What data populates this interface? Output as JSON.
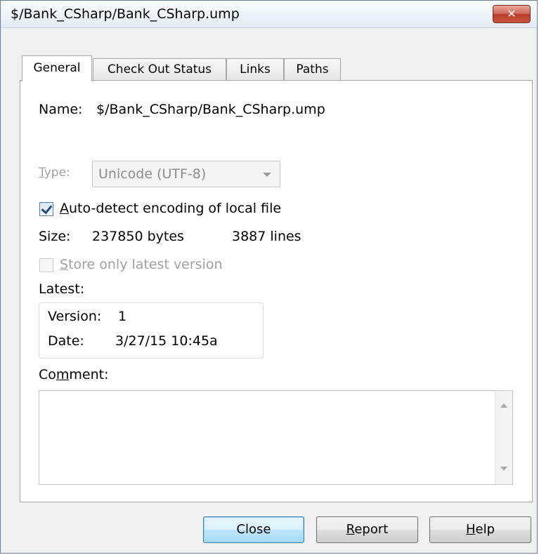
{
  "window": {
    "title": "$/Bank_CSharp/Bank_CSharp.ump",
    "close_glyph": "✕"
  },
  "tabs": [
    {
      "label": "General",
      "active": true
    },
    {
      "label": "Check Out Status",
      "active": false
    },
    {
      "label": "Links",
      "active": false
    },
    {
      "label": "Paths",
      "active": false
    }
  ],
  "general": {
    "name_label": "Name:",
    "name_value": "$/Bank_CSharp/Bank_CSharp.ump",
    "type_label_prefix": "T",
    "type_label_rest": "ype:",
    "type_value": "Unicode (UTF-8)",
    "auto_detect": {
      "accel": "A",
      "rest": "uto-detect encoding of local file",
      "checked": true
    },
    "size_label": "Size:",
    "size_bytes": "237850 bytes",
    "size_lines": "3887 lines",
    "store_latest": {
      "accel": "S",
      "rest": "tore only latest version",
      "checked": false,
      "enabled": false
    },
    "latest_label": "Latest:",
    "version_label": "Version:",
    "version_value": "1",
    "date_label": "Date:",
    "date_value": "3/27/15  10:45a",
    "comment_prefix": "Co",
    "comment_accel": "m",
    "comment_rest": "ment:",
    "comment_text": ""
  },
  "buttons": {
    "close": "Close",
    "report_accel": "R",
    "report_rest": "eport",
    "help_accel": "H",
    "help_rest": "elp"
  },
  "colors": {
    "title_close_red": "#c9543f",
    "default_button_blue": "#bee6fd",
    "disabled_text": "#a0a0a0"
  }
}
